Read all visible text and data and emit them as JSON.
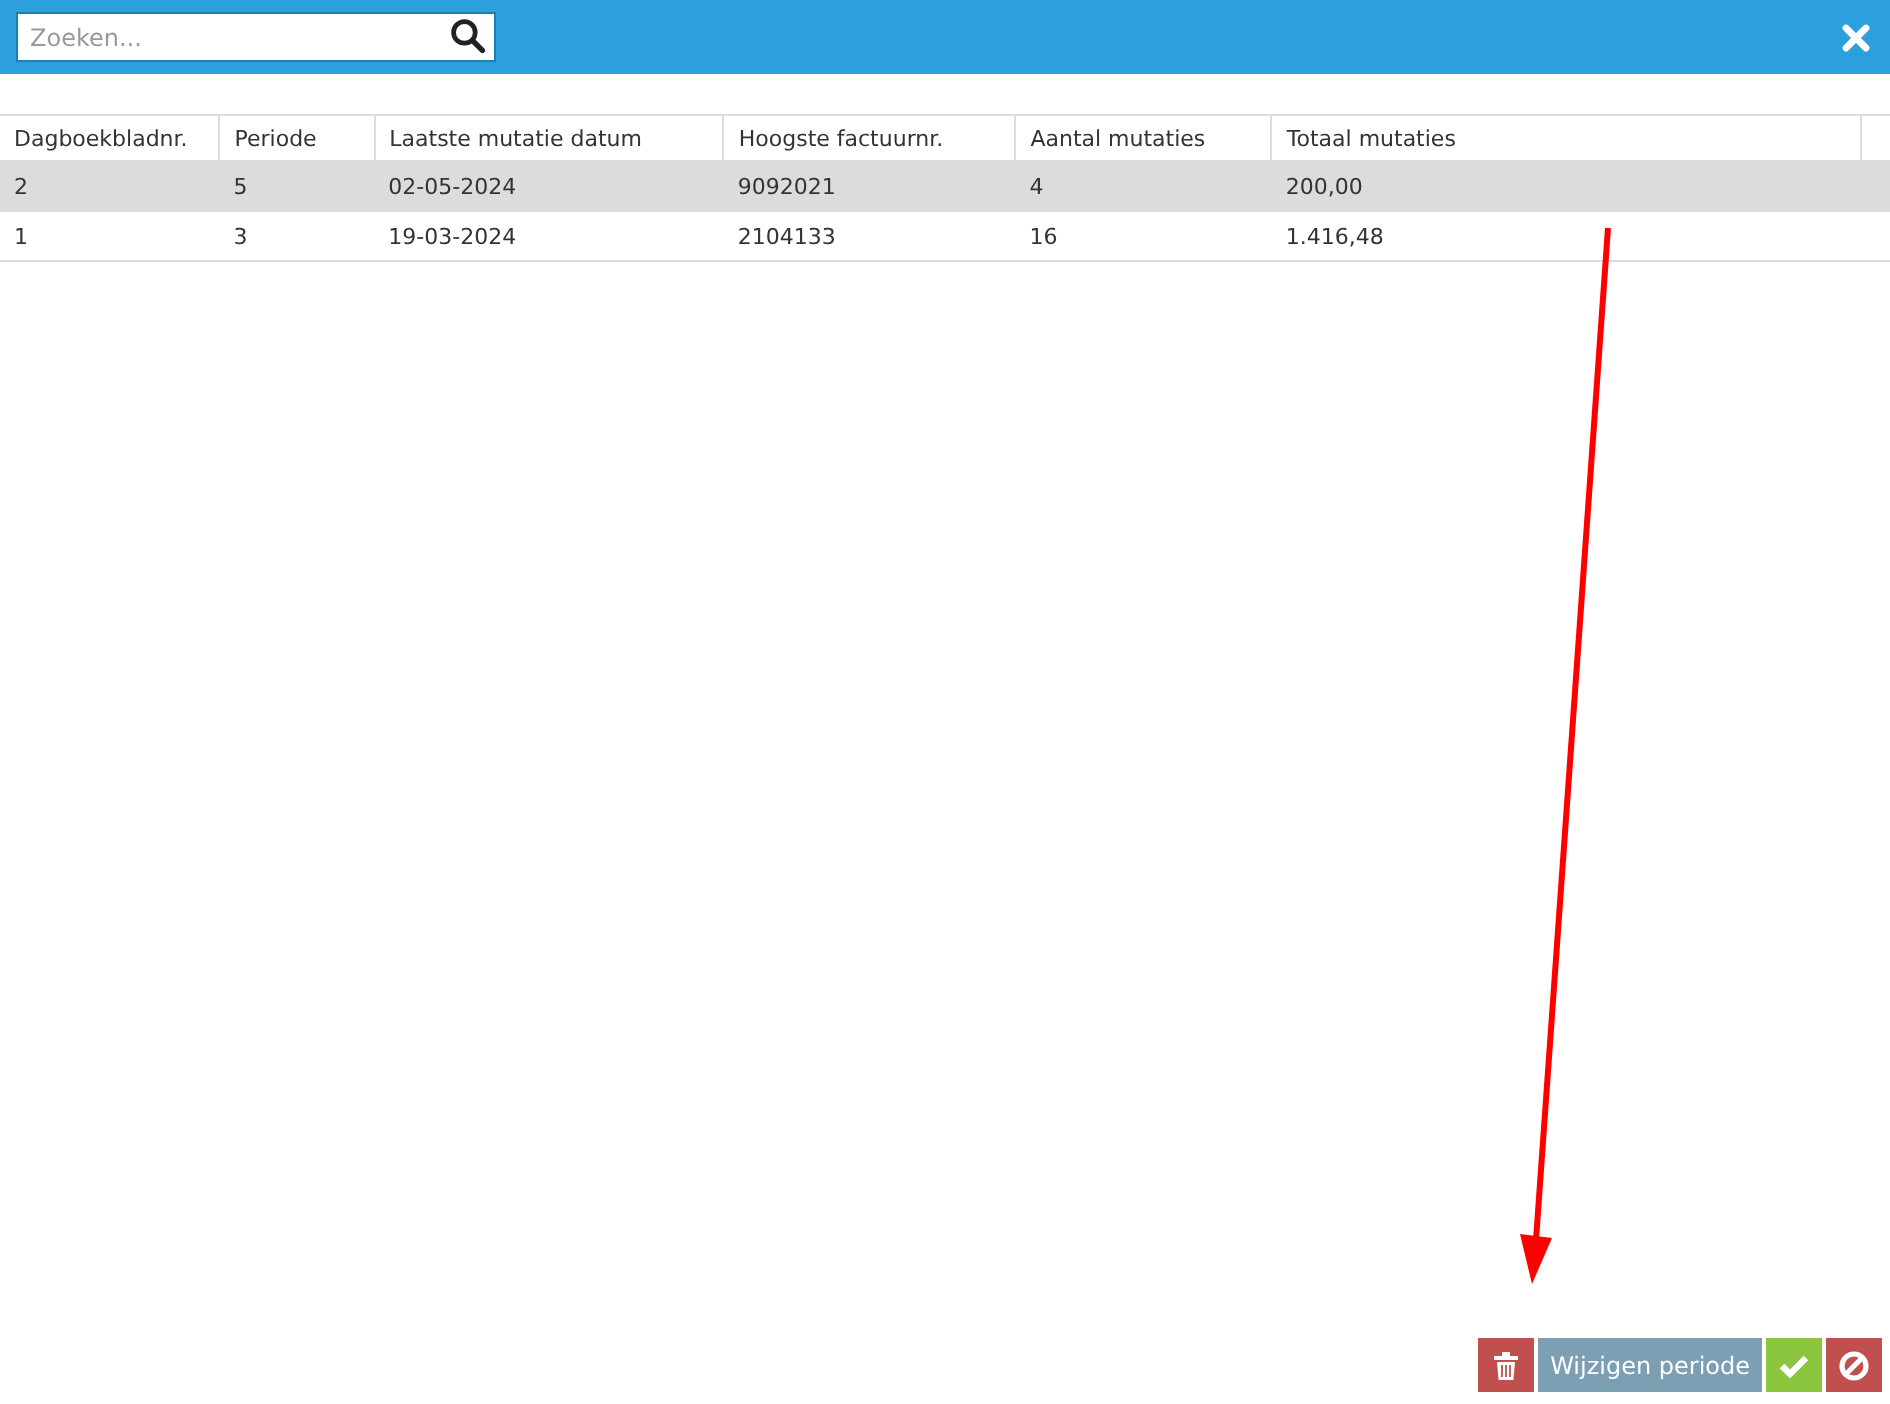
{
  "search": {
    "placeholder": "Zoeken..."
  },
  "table": {
    "columns": [
      "Dagboekbladnr.",
      "Periode",
      "Laatste mutatie datum",
      "Hoogste factuurnr.",
      "Aantal mutaties",
      "Totaal mutaties"
    ],
    "rows": [
      {
        "cells": [
          "2",
          "5",
          "02-05-2024",
          "9092021",
          "4",
          "200,00"
        ],
        "selected": true
      },
      {
        "cells": [
          "1",
          "3",
          "19-03-2024",
          "2104133",
          "16",
          "1.416,48"
        ],
        "selected": false
      }
    ]
  },
  "buttons": [
    {
      "kind": "delete"
    },
    {
      "kind": "text",
      "label": "Wijzigen periode"
    },
    {
      "kind": "confirm"
    },
    {
      "kind": "cancel"
    }
  ]
}
